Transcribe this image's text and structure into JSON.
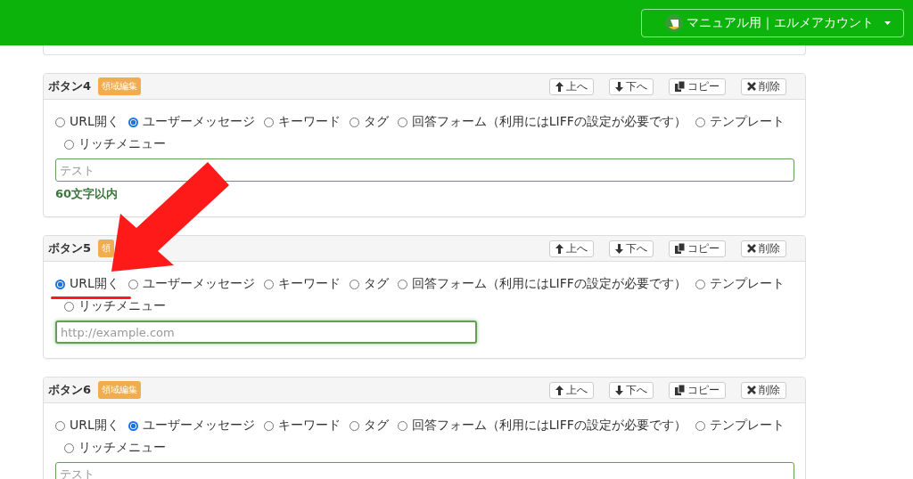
{
  "header": {
    "account": "マニュアル用｜エルメアカウント"
  },
  "panels": [
    {
      "title": "ボタン4",
      "badge": "領域編集",
      "actions": [
        {
          "kind": "up",
          "label": "上へ"
        },
        {
          "kind": "down",
          "label": "下へ"
        },
        {
          "kind": "copy",
          "label": "コピー"
        },
        {
          "kind": "delete",
          "label": "削除"
        }
      ],
      "options": [
        {
          "label": "URL開く",
          "selected": false
        },
        {
          "label": "ユーザーメッセージ",
          "selected": true
        },
        {
          "label": "キーワード",
          "selected": false
        },
        {
          "label": "タグ",
          "selected": false
        },
        {
          "label": "回答フォーム（利用にはLIFFの設定が必要です）",
          "selected": false
        },
        {
          "label": "テンプレート",
          "selected": false
        },
        {
          "label": "リッチメニュー",
          "selected": false
        }
      ],
      "field": {
        "placeholder": "テスト",
        "focused": false
      },
      "note": "60文字以内"
    },
    {
      "title": "ボタン5",
      "badge": "領",
      "actions": [
        {
          "kind": "up",
          "label": "上へ"
        },
        {
          "kind": "down",
          "label": "下へ"
        },
        {
          "kind": "copy",
          "label": "コピー"
        },
        {
          "kind": "delete",
          "label": "削除"
        }
      ],
      "options": [
        {
          "label": "URL開く",
          "selected": true
        },
        {
          "label": "ユーザーメッセージ",
          "selected": false
        },
        {
          "label": "キーワード",
          "selected": false
        },
        {
          "label": "タグ",
          "selected": false
        },
        {
          "label": "回答フォーム（利用にはLIFFの設定が必要です）",
          "selected": false
        },
        {
          "label": "テンプレート",
          "selected": false
        },
        {
          "label": "リッチメニュー",
          "selected": false
        }
      ],
      "field": {
        "placeholder": "http://example.com",
        "focused": true
      }
    },
    {
      "title": "ボタン6",
      "badge": "領域編集",
      "actions": [
        {
          "kind": "up",
          "label": "上へ"
        },
        {
          "kind": "down",
          "label": "下へ"
        },
        {
          "kind": "copy",
          "label": "コピー"
        },
        {
          "kind": "delete",
          "label": "削除"
        }
      ],
      "options": [
        {
          "label": "URL開く",
          "selected": false
        },
        {
          "label": "ユーザーメッセージ",
          "selected": true
        },
        {
          "label": "キーワード",
          "selected": false
        },
        {
          "label": "タグ",
          "selected": false
        },
        {
          "label": "回答フォーム（利用にはLIFFの設定が必要です）",
          "selected": false
        },
        {
          "label": "テンプレート",
          "selected": false
        },
        {
          "label": "リッチメニュー",
          "selected": false
        }
      ],
      "field": {
        "placeholder": "テスト",
        "focused": false
      }
    }
  ]
}
